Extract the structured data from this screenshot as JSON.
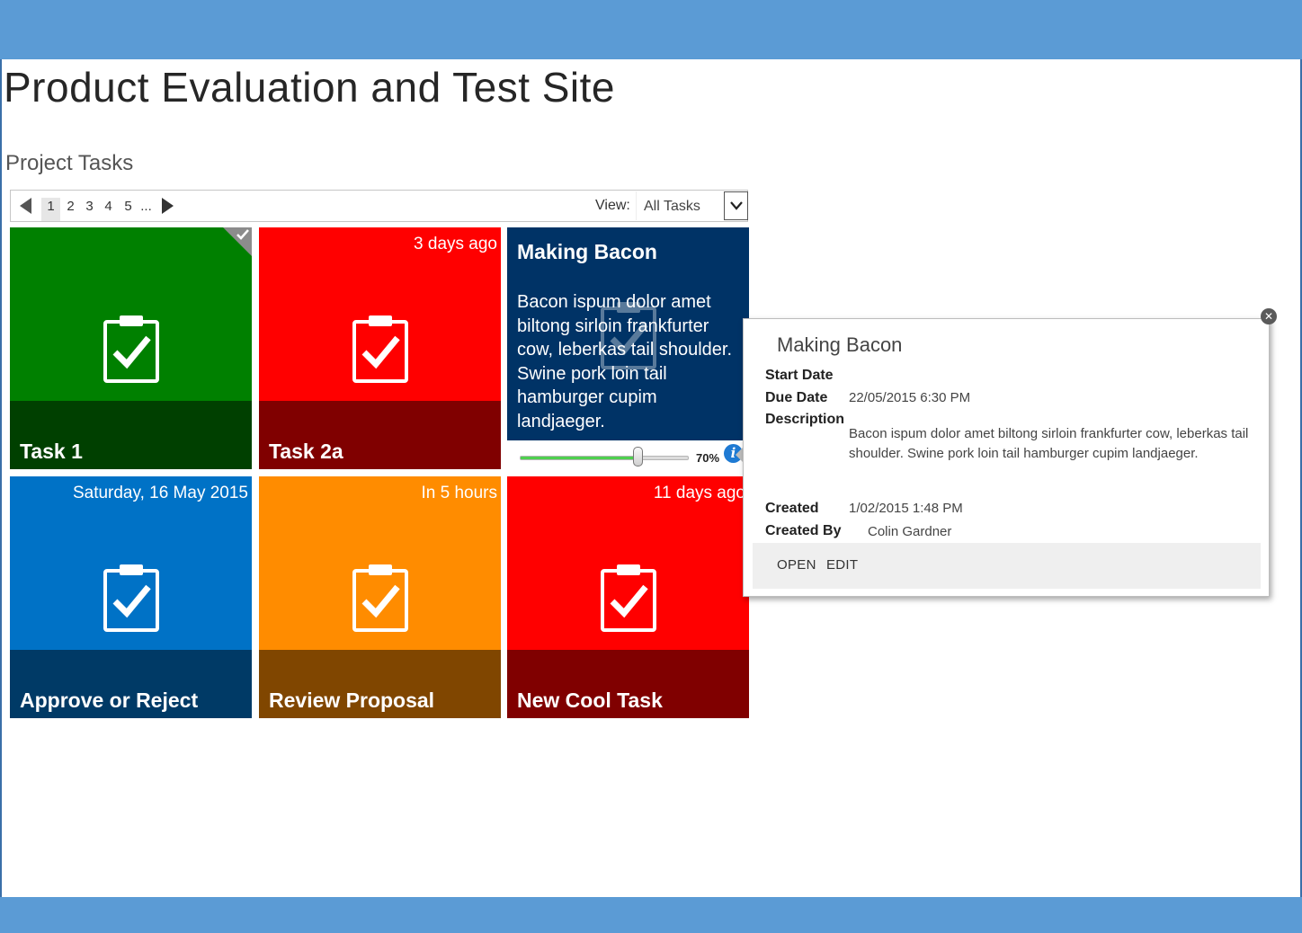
{
  "site": {
    "title": "Product Evaluation and Test Site"
  },
  "section": {
    "title": "Project Tasks"
  },
  "pager": {
    "pages": [
      "1",
      "2",
      "3",
      "4",
      "5",
      "..."
    ],
    "view_label": "View:",
    "view_value": "All Tasks"
  },
  "tiles": [
    {
      "name": "Task 1",
      "date": "",
      "color": "#008000",
      "band_color": "#004000",
      "completed": true
    },
    {
      "name": "Task 2a",
      "date": "3 days ago",
      "color": "#ff0000",
      "band_color": "#800000"
    },
    {
      "name": "Making Bacon",
      "description": "Bacon ispum dolor amet biltong sirloin frankfurter cow, leberkas tail shoulder. Swine pork loin tail hamburger cupim landjaeger.",
      "color": "#003366",
      "progress_percent": 70,
      "progress_label": "70%"
    },
    {
      "name": "Approve or Reject",
      "date": "Saturday, 16 May 2015",
      "color": "#0072c6",
      "band_color": "#003a66"
    },
    {
      "name": "Review Proposal",
      "date": "In 5 hours",
      "color": "#ff8c00",
      "band_color": "#804600"
    },
    {
      "name": "New Cool Task",
      "date": "11 days ago",
      "color": "#ff0000",
      "band_color": "#800000"
    }
  ],
  "callout": {
    "title": "Making Bacon",
    "start_date_label": "Start Date",
    "due_date_label": "Due Date",
    "due_date_value": "22/05/2015 6:30 PM",
    "description_label": "Description",
    "description_value": "Bacon ispum dolor amet biltong sirloin frankfurter cow, leberkas tail shoulder. Swine pork loin tail hamburger cupim landjaeger.",
    "created_label": "Created",
    "created_value": "1/02/2015 1:48 PM",
    "created_by_label": "Created By",
    "created_by_value": "Colin Gardner",
    "open_label": "OPEN",
    "edit_label": "EDIT"
  },
  "icons": {
    "task": "clipboard-check-icon",
    "prev": "triangle-left-icon",
    "next": "triangle-right-icon",
    "dropdown": "chevron-down-icon",
    "info": "info-icon",
    "close": "close-icon"
  }
}
